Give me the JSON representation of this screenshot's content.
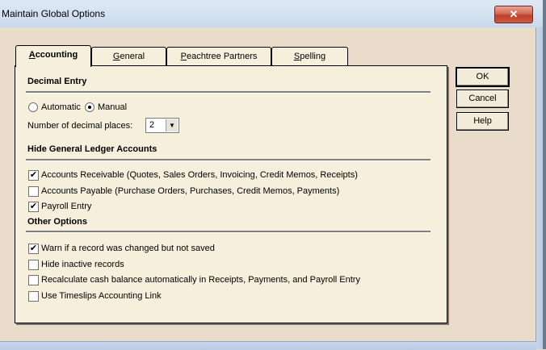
{
  "window": {
    "title": "Maintain Global Options",
    "close_glyph": "✕"
  },
  "tabs": [
    {
      "pre": "",
      "ul": "A",
      "post": "ccounting"
    },
    {
      "pre": "",
      "ul": "G",
      "post": "eneral"
    },
    {
      "pre": "",
      "ul": "P",
      "post": "eachtree Partners"
    },
    {
      "pre": "",
      "ul": "S",
      "post": "pelling"
    }
  ],
  "decimal_entry": {
    "heading": "Decimal Entry",
    "automatic_label": "Automatic",
    "manual_label": "Manual",
    "selected": "Manual",
    "places_label": "Number of decimal places:",
    "places_value": "2"
  },
  "hide_gl": {
    "heading": "Hide General Ledger Accounts",
    "items": [
      {
        "label": "Accounts Receivable (Quotes, Sales Orders, Invoicing, Credit Memos, Receipts)",
        "checked": true
      },
      {
        "label": "Accounts Payable (Purchase Orders, Purchases, Credit Memos, Payments)",
        "checked": false
      },
      {
        "label": "Payroll Entry",
        "checked": true
      }
    ]
  },
  "other_options": {
    "heading": "Other Options",
    "items": [
      {
        "label": "Warn if a record was changed but not saved",
        "checked": true
      },
      {
        "label": "Hide inactive records",
        "checked": false
      },
      {
        "label": "Recalculate cash balance automatically in Receipts, Payments, and Payroll Entry",
        "checked": false
      },
      {
        "label": "Use Timeslips Accounting Link",
        "checked": false
      }
    ]
  },
  "buttons": {
    "ok": "OK",
    "cancel": "Cancel",
    "help": "Help"
  },
  "colors": {
    "dialog_bg": "#e9dccb",
    "panel_bg": "#f5efdc",
    "close_red": "#c0402b"
  }
}
